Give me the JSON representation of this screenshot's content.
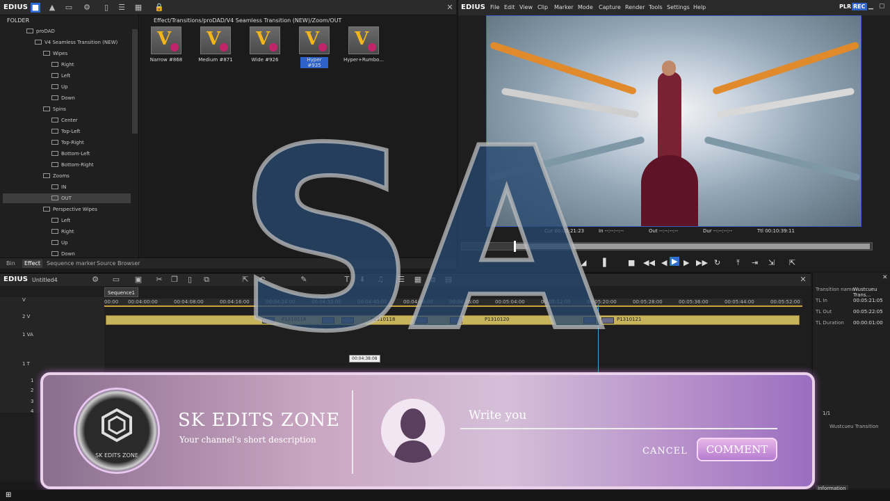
{
  "bin": {
    "app_name": "EDIUS",
    "folder_header": "FOLDER",
    "path": "Effect/Transitions/proDAD/V4 Seamless Transition (NEW)/Zoom/OUT",
    "tree": [
      {
        "label": "proDAD",
        "indent": 0
      },
      {
        "label": "V4 Seamless Transition (NEW)",
        "indent": 1
      },
      {
        "label": "Wipes",
        "indent": 2
      },
      {
        "label": "Right",
        "indent": 3
      },
      {
        "label": "Left",
        "indent": 3
      },
      {
        "label": "Up",
        "indent": 3
      },
      {
        "label": "Down",
        "indent": 3
      },
      {
        "label": "Spins",
        "indent": 2
      },
      {
        "label": "Center",
        "indent": 3
      },
      {
        "label": "Top-Left",
        "indent": 3
      },
      {
        "label": "Top-Right",
        "indent": 3
      },
      {
        "label": "Bottom-Left",
        "indent": 3
      },
      {
        "label": "Bottom-Right",
        "indent": 3
      },
      {
        "label": "Zooms",
        "indent": 2
      },
      {
        "label": "IN",
        "indent": 3
      },
      {
        "label": "OUT",
        "indent": 3,
        "selected": true
      },
      {
        "label": "Perspective Wipes",
        "indent": 2
      },
      {
        "label": "Left",
        "indent": 3
      },
      {
        "label": "Right",
        "indent": 3
      },
      {
        "label": "Up",
        "indent": 3
      },
      {
        "label": "Down",
        "indent": 3
      }
    ],
    "thumbnails": [
      {
        "label": "Narrow #868"
      },
      {
        "label": "Medium #871"
      },
      {
        "label": "Wide #926"
      },
      {
        "label": "Hyper #935",
        "selected": true
      },
      {
        "label": "Hyper+Rumbo..."
      }
    ],
    "tabs": [
      "Bin",
      "Effect",
      "Sequence marker",
      "Source Browser"
    ],
    "active_tab": "Effect"
  },
  "player": {
    "app_name": "EDIUS",
    "menu": [
      "File",
      "Edit",
      "View",
      "Clip",
      "Marker",
      "Mode",
      "Capture",
      "Render",
      "Tools",
      "Settings",
      "Help"
    ],
    "mode_plr": "PLR",
    "mode_rec": "REC",
    "cur": "Cur 00:05:21:23",
    "in": "In --:--:--:--",
    "out": "Out --:--:--:--",
    "dur": "Dur --:--:--:--",
    "ttl": "Ttl 00:10:39:11"
  },
  "timeline": {
    "app_name": "EDIUS",
    "project": "Untitled4",
    "sequence_tab": "Sequence1",
    "ruler": [
      "00:00",
      "00:04:00:00",
      "00:04:08:00",
      "00:04:16:00",
      "00:04:24:00",
      "00:04:32:00",
      "00:04:40:00",
      "00:04:48:00",
      "00:04:56:00",
      "00:05:04:00",
      "00:05:12:00",
      "00:05:20:00",
      "00:05:28:00",
      "00:05:36:00",
      "00:05:44:00",
      "00:05:52:00"
    ],
    "tracks": [
      "V",
      "2 V",
      "1 VA",
      "1 T",
      "1",
      "2",
      "3",
      "4"
    ],
    "clips": [
      "P1310116",
      "P1310118",
      "P1310120",
      "P1310121"
    ],
    "tooltip": "00:04:38:08"
  },
  "info": {
    "rows": [
      {
        "k": "Transition name",
        "v": "Wustcueu Trans..."
      },
      {
        "k": "TL In",
        "v": "00:05:21:05"
      },
      {
        "k": "TL Out",
        "v": "00:05:22:05"
      },
      {
        "k": "TL Duration",
        "v": "00:00:01:00"
      }
    ],
    "page": "1/1",
    "list_item": "Wustcueu Transition",
    "footer": "Information"
  },
  "watermark": {
    "text": "SA"
  },
  "overlay": {
    "logo_text": "SK EDITS ZONE",
    "title": "SK EDITS ZONE",
    "description": "Your channel's short description",
    "input_placeholder": "Write you",
    "cancel_label": "CANCEL",
    "comment_label": "COMMENT"
  }
}
